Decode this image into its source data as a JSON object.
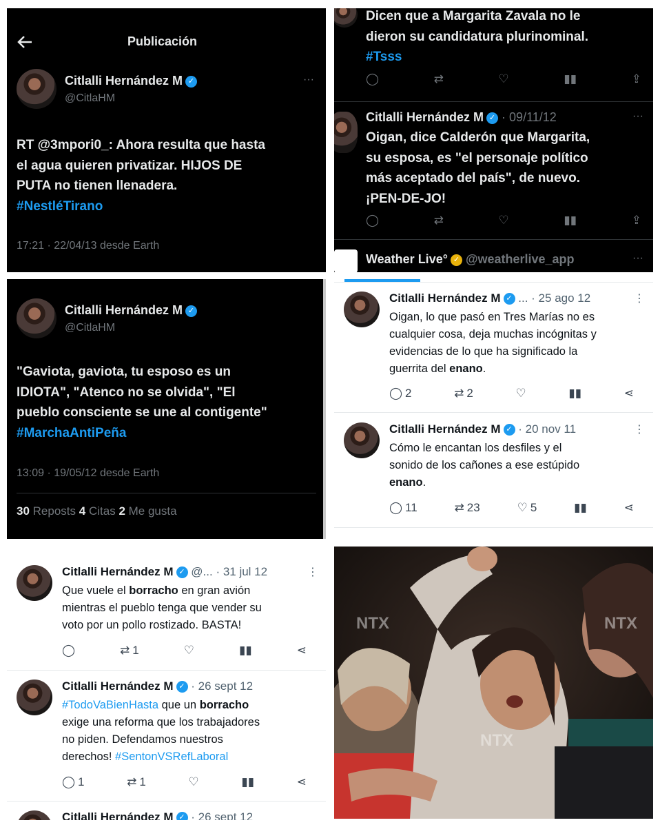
{
  "panel1": {
    "back_icon": "arrow-left-icon",
    "header_title": "Publicación",
    "name": "Citlalli Hernández M",
    "handle": "@CitlaHM",
    "text_1": "RT @3mpori0_: Ahora resulta que hasta",
    "text_2": "el agua quieren privatizar. HIJOS DE",
    "text_3": "PUTA no tienen llenadera.",
    "hashtag": "#NestléTirano",
    "meta": "17:21 · 22/04/13 desde Earth"
  },
  "panel2": {
    "line_1": "Dicen que a Margarita Zavala no le",
    "line_2": "dieron su candidatura plurinominal.",
    "hashtag": "#Tsss",
    "tweet2_name": "Citlalli Hernández M",
    "tweet2_date": "· 09/11/12",
    "tweet2_l1": "Oigan, dice Calderón que Margarita,",
    "tweet2_l2": "su esposa, es \"el personaje político",
    "tweet2_l3": "más aceptado del país\", de nuevo.",
    "tweet2_l4": "¡PEN-DE-JO!",
    "weather_name": "Weather Live°",
    "weather_handle": "@weatherlive_app"
  },
  "panel3": {
    "name": "Citlalli Hernández M",
    "handle": "@CitlaHM",
    "text_1": "\"Gaviota, gaviota, tu esposo es un",
    "text_2": "IDIOTA\", \"Atenco no se olvida\", \"El",
    "text_3": "pueblo consciente se une al contigente\"",
    "hashtag": "#MarchaAntiPeña",
    "meta": "13:09 · 19/05/12 desde Earth",
    "reposts_count": "30",
    "reposts_label": "Reposts",
    "quotes_count": "4",
    "quotes_label": "Citas",
    "likes_count": "2",
    "likes_label": "Me gusta"
  },
  "panel4": {
    "t1_name": "Citlalli Hernández M",
    "t1_handle": "...",
    "t1_date": "· 25 ago 12",
    "t1_l1": "Oigan, lo que pasó en Tres Marías no es",
    "t1_l2": "cualquier cosa, deja muchas incógnitas y",
    "t1_l3": "evidencias de lo que ha significado la",
    "t1_l4a": "guerrita del ",
    "t1_l4b": "enano",
    "t1_l4c": ".",
    "t1_replies": "2",
    "t1_retweets": "2",
    "t2_name": "Citlalli Hernández M",
    "t2_date": "· 20 nov 11",
    "t2_l1": "Cómo le encantan los desfiles y el",
    "t2_l2": "sonido de los cañones a ese estúpido",
    "t2_l3": "enano",
    "t2_l3b": ".",
    "t2_replies": "11",
    "t2_retweets": "23",
    "t2_likes": "5"
  },
  "panel5": {
    "t1_name": "Citlalli Hernández M",
    "t1_handle": "@...",
    "t1_date": "· 31 jul 12",
    "t1_l1a": "Que vuele el ",
    "t1_l1b": "borracho",
    "t1_l1c": " en gran avión",
    "t1_l2": "mientras el pueblo tenga que vender su",
    "t1_l3": "voto por un pollo rostizado. BASTA!",
    "t1_retweets": "1",
    "t2_name": "Citlalli Hernández M",
    "t2_date": "· 26 sept 12",
    "t2_l1a": "#TodoVaBienHasta",
    "t2_l1b": " que un ",
    "t2_l1c": "borracho",
    "t2_l2": "exige una reforma que los trabajadores",
    "t2_l3": "no piden. Defendamos nuestros",
    "t2_l4a": "derechos! ",
    "t2_l4b": "#SentonVSRefLaboral",
    "t2_replies": "1",
    "t2_retweets": "1",
    "t3_name": "Citlalli Hernández M",
    "t3_date": "· 26 sept 12"
  },
  "panel6": {
    "watermark": "NTX"
  },
  "colors": {
    "accent": "#1d9bf0",
    "dark_bg": "#000000",
    "muted": "#71767b",
    "gold_badge": "#e8b20b"
  }
}
